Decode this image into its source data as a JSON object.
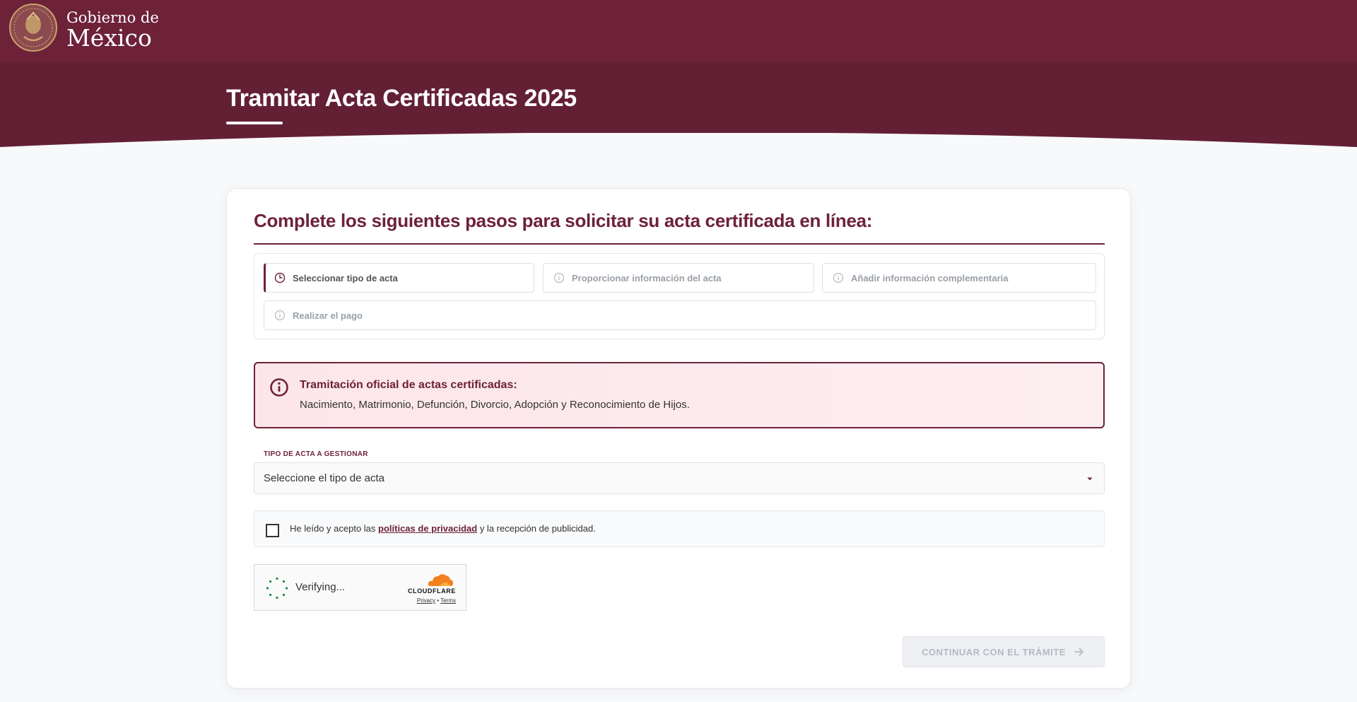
{
  "header": {
    "brand_line1": "Gobierno de",
    "brand_line2": "México",
    "page_title": "Tramitar Acta Certificadas 2025"
  },
  "form": {
    "heading": "Complete los siguientes pasos para solicitar su acta certificada en línea:",
    "steps": [
      {
        "label": "Seleccionar tipo de acta",
        "state": "active"
      },
      {
        "label": "Proporcionar información del acta",
        "state": "pending"
      },
      {
        "label": "Añadir información complementaria",
        "state": "pending"
      },
      {
        "label": "Realizar el pago",
        "state": "pending"
      }
    ],
    "alert": {
      "title": "Tramitación oficial de actas certificadas:",
      "text": "Nacimiento, Matrimonio, Defunción, Divorcio, Adopción y Reconocimiento de Hijos."
    },
    "acta_type": {
      "label": "TIPO DE ACTA A GESTIONAR",
      "value": "Seleccione el tipo de acta"
    },
    "consent": {
      "prefix": "He leído y acepto las",
      "link": "políticas de privacidad",
      "suffix": "y la recepción de publicidad.",
      "checked": false
    },
    "captcha": {
      "status": "Verifying...",
      "brand": "CLOUDFLARE",
      "privacy": "Privacy",
      "separator": "•",
      "terms": "Terms"
    },
    "continue_label": "CONTINUAR CON EL TRÁMITE"
  },
  "colors": {
    "brand": "#6d2239",
    "hero": "#632035",
    "alert_bg": "#fce6ea",
    "cloudflare": "#f38020"
  },
  "icons": {
    "active_step": "clock-icon",
    "pending_step": "info-circle-icon",
    "alert": "info-circle-icon",
    "select": "caret-down-icon",
    "continue": "arrow-right-icon"
  }
}
